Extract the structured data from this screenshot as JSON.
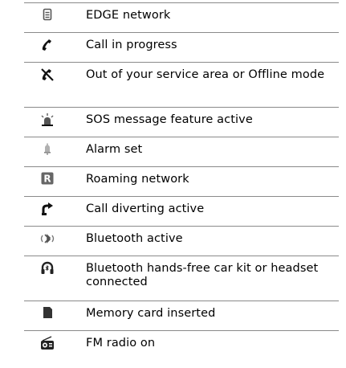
{
  "rows": [
    {
      "icon": "edge-network-icon",
      "text": "EDGE network"
    },
    {
      "icon": "call-in-progress-icon",
      "text": "Call in progress"
    },
    {
      "icon": "out-of-service-icon",
      "text": "Out of your service area or Offline mode"
    },
    {
      "icon": "sos-message-icon",
      "text": "SOS message feature active"
    },
    {
      "icon": "alarm-bell-icon",
      "text": "Alarm set"
    },
    {
      "icon": "roaming-network-icon",
      "text": "Roaming network"
    },
    {
      "icon": "call-divert-icon",
      "text": "Call diverting active"
    },
    {
      "icon": "bluetooth-active-icon",
      "text": "Bluetooth active"
    },
    {
      "icon": "bluetooth-headset-icon",
      "text": "Bluetooth hands-free car kit or headset connected"
    },
    {
      "icon": "memory-card-icon",
      "text": "Memory card inserted"
    },
    {
      "icon": "fm-radio-icon",
      "text": "FM radio on"
    }
  ]
}
